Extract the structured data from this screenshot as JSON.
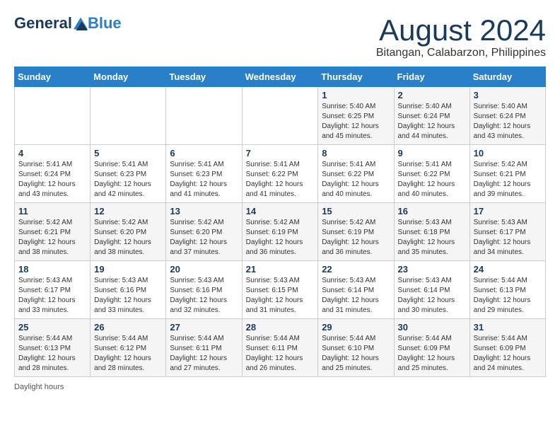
{
  "header": {
    "logo_general": "General",
    "logo_blue": "Blue",
    "month_title": "August 2024",
    "location": "Bitangan, Calabarzon, Philippines"
  },
  "days_of_week": [
    "Sunday",
    "Monday",
    "Tuesday",
    "Wednesday",
    "Thursday",
    "Friday",
    "Saturday"
  ],
  "footer": {
    "note": "Daylight hours"
  },
  "weeks": [
    {
      "days": [
        {
          "num": "",
          "info": ""
        },
        {
          "num": "",
          "info": ""
        },
        {
          "num": "",
          "info": ""
        },
        {
          "num": "",
          "info": ""
        },
        {
          "num": "1",
          "info": "Sunrise: 5:40 AM\nSunset: 6:25 PM\nDaylight: 12 hours\nand 45 minutes."
        },
        {
          "num": "2",
          "info": "Sunrise: 5:40 AM\nSunset: 6:24 PM\nDaylight: 12 hours\nand 44 minutes."
        },
        {
          "num": "3",
          "info": "Sunrise: 5:40 AM\nSunset: 6:24 PM\nDaylight: 12 hours\nand 43 minutes."
        }
      ]
    },
    {
      "days": [
        {
          "num": "4",
          "info": "Sunrise: 5:41 AM\nSunset: 6:24 PM\nDaylight: 12 hours\nand 43 minutes."
        },
        {
          "num": "5",
          "info": "Sunrise: 5:41 AM\nSunset: 6:23 PM\nDaylight: 12 hours\nand 42 minutes."
        },
        {
          "num": "6",
          "info": "Sunrise: 5:41 AM\nSunset: 6:23 PM\nDaylight: 12 hours\nand 41 minutes."
        },
        {
          "num": "7",
          "info": "Sunrise: 5:41 AM\nSunset: 6:22 PM\nDaylight: 12 hours\nand 41 minutes."
        },
        {
          "num": "8",
          "info": "Sunrise: 5:41 AM\nSunset: 6:22 PM\nDaylight: 12 hours\nand 40 minutes."
        },
        {
          "num": "9",
          "info": "Sunrise: 5:41 AM\nSunset: 6:22 PM\nDaylight: 12 hours\nand 40 minutes."
        },
        {
          "num": "10",
          "info": "Sunrise: 5:42 AM\nSunset: 6:21 PM\nDaylight: 12 hours\nand 39 minutes."
        }
      ]
    },
    {
      "days": [
        {
          "num": "11",
          "info": "Sunrise: 5:42 AM\nSunset: 6:21 PM\nDaylight: 12 hours\nand 38 minutes."
        },
        {
          "num": "12",
          "info": "Sunrise: 5:42 AM\nSunset: 6:20 PM\nDaylight: 12 hours\nand 38 minutes."
        },
        {
          "num": "13",
          "info": "Sunrise: 5:42 AM\nSunset: 6:20 PM\nDaylight: 12 hours\nand 37 minutes."
        },
        {
          "num": "14",
          "info": "Sunrise: 5:42 AM\nSunset: 6:19 PM\nDaylight: 12 hours\nand 36 minutes."
        },
        {
          "num": "15",
          "info": "Sunrise: 5:42 AM\nSunset: 6:19 PM\nDaylight: 12 hours\nand 36 minutes."
        },
        {
          "num": "16",
          "info": "Sunrise: 5:43 AM\nSunset: 6:18 PM\nDaylight: 12 hours\nand 35 minutes."
        },
        {
          "num": "17",
          "info": "Sunrise: 5:43 AM\nSunset: 6:17 PM\nDaylight: 12 hours\nand 34 minutes."
        }
      ]
    },
    {
      "days": [
        {
          "num": "18",
          "info": "Sunrise: 5:43 AM\nSunset: 6:17 PM\nDaylight: 12 hours\nand 33 minutes."
        },
        {
          "num": "19",
          "info": "Sunrise: 5:43 AM\nSunset: 6:16 PM\nDaylight: 12 hours\nand 33 minutes."
        },
        {
          "num": "20",
          "info": "Sunrise: 5:43 AM\nSunset: 6:16 PM\nDaylight: 12 hours\nand 32 minutes."
        },
        {
          "num": "21",
          "info": "Sunrise: 5:43 AM\nSunset: 6:15 PM\nDaylight: 12 hours\nand 31 minutes."
        },
        {
          "num": "22",
          "info": "Sunrise: 5:43 AM\nSunset: 6:14 PM\nDaylight: 12 hours\nand 31 minutes."
        },
        {
          "num": "23",
          "info": "Sunrise: 5:43 AM\nSunset: 6:14 PM\nDaylight: 12 hours\nand 30 minutes."
        },
        {
          "num": "24",
          "info": "Sunrise: 5:44 AM\nSunset: 6:13 PM\nDaylight: 12 hours\nand 29 minutes."
        }
      ]
    },
    {
      "days": [
        {
          "num": "25",
          "info": "Sunrise: 5:44 AM\nSunset: 6:13 PM\nDaylight: 12 hours\nand 28 minutes."
        },
        {
          "num": "26",
          "info": "Sunrise: 5:44 AM\nSunset: 6:12 PM\nDaylight: 12 hours\nand 28 minutes."
        },
        {
          "num": "27",
          "info": "Sunrise: 5:44 AM\nSunset: 6:11 PM\nDaylight: 12 hours\nand 27 minutes."
        },
        {
          "num": "28",
          "info": "Sunrise: 5:44 AM\nSunset: 6:11 PM\nDaylight: 12 hours\nand 26 minutes."
        },
        {
          "num": "29",
          "info": "Sunrise: 5:44 AM\nSunset: 6:10 PM\nDaylight: 12 hours\nand 25 minutes."
        },
        {
          "num": "30",
          "info": "Sunrise: 5:44 AM\nSunset: 6:09 PM\nDaylight: 12 hours\nand 25 minutes."
        },
        {
          "num": "31",
          "info": "Sunrise: 5:44 AM\nSunset: 6:09 PM\nDaylight: 12 hours\nand 24 minutes."
        }
      ]
    }
  ]
}
